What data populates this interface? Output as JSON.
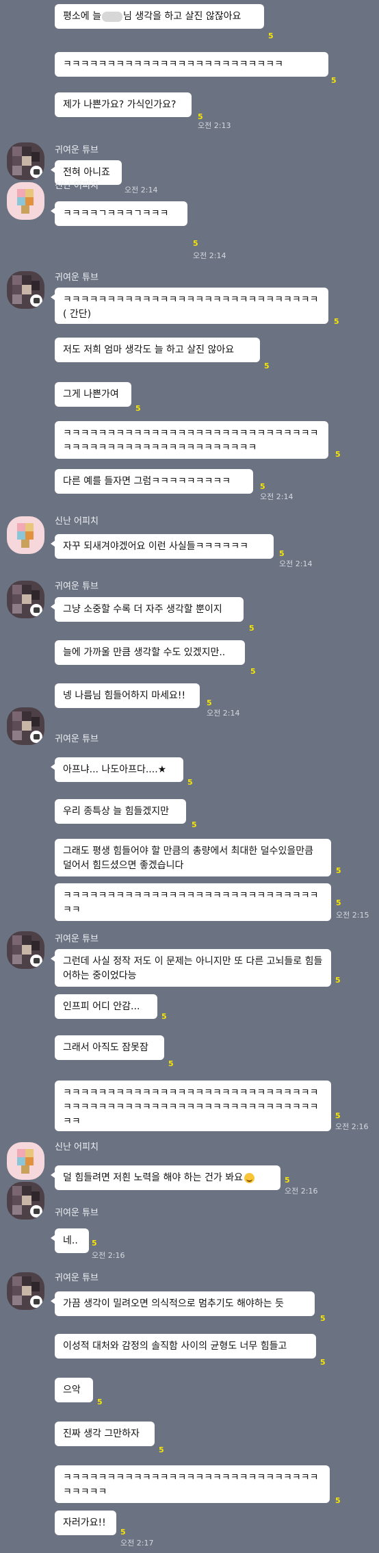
{
  "read_marker": "5",
  "senders": {
    "tube": "귀여운 튜브",
    "apeach": "신난 어피치"
  },
  "messages": {
    "m1a": "평소에 늘",
    "m1b": "님 생각을 하고 살진 않잖아요",
    "m2": "ㅋㅋㅋㅋㅋㅋㅋㅋㅋㅋㅋㅋㅋㅋㅋㅋㅋㅋㅋㅋㅋㅋㅋㅋㅋ",
    "m3": "제가 나쁜가요? 가식인가요?",
    "m4": "전혀 아니죠",
    "m5": "ㅋㅋㅋㅋㄱㅋㅋㅋㄱㅋㅋㅋ",
    "m6": "ㅋㅋㅋㅋㅋㅋㅋㅋㅋㅋㅋㅋㅋㅋㅋㅋㅋㅋㅋㅋㅋㅋㅋㅋㅋㅋㅋㅋㅋ( 간단)",
    "m7": "저도 저희 엄마 생각도 늘 하고 살진 않아요",
    "m8": "그게 나쁜가여",
    "m9": "ㅋㅋㅋㅋㅋㅋㅋㅋㅋㅋㅋㅋㅋㅋㅋㅋㅋㅋㅋㅋㅋㅋㅋㅋㅋㅋㅋㅋㅋㅋㅋㅋㅋㅋㅋㅋㅋㅋㅋㅋㅋㅋㅋㅋㅋㅋㅋㅋㅋㅋㅋ",
    "m10": "다른 예를 들자면 그럼ㅋㅋㅋㅋㅋㅋㅋㅋㅋ",
    "m11": "자꾸 되새겨야겠어요 이런 사실들ㅋㅋㅋㅋㅋㅋ",
    "m12": "그냥 소중할 수록 더 자주 생각할 뿐이지",
    "m13": "늘에 가까울 만큼 생각할 수도 있겠지만..",
    "m14": "넹 나름님 힘들어하지 마세요!!",
    "m15": "아프냐... 나도아프다....★",
    "m16": "우리 종특상 늘 힘들겠지만",
    "m17": "그래도 평생 힘들어야 할 만큼의 총량에서 최대한 덜수있을만큼 덜어서 힘드셨으면 좋겠습니다",
    "m18": "ㅋㅋㅋㅋㅋㅋㅋㅋㅋㅋㅋㅋㅋㅋㅋㅋㅋㅋㅋㅋㅋㅋㅋㅋㅋㅋㅋㅋㅋㅋㅋ",
    "m19": "그런데 사실 정작 저도 이 문제는 아니지만 또 다른 고뇌들로 힘들어하는 중이었다능",
    "m20": "인프피 어디 안감...",
    "m21": "그래서 아직도 잠못잠",
    "m22": "ㅋㅋㅋㅋㅋㅋㅋㅋㅋㅋㅋㅋㅋㅋㅋㅋㅋㅋㅋㅋㅋㅋㅋㅋㅋㅋㅋㅋㅋㅋㅋㅋㅋㅋㅋㅋㅋㅋㅋㅋㅋㅋㅋㅋㅋㅋㅋㅋㅋㅋㅋㅋㅋㅋㅋㅋㅋㅋㅋㅋ",
    "m23": "덜 힘들려면 저흰 노력을 해야 하는 건가 봐요",
    "m24": "네..",
    "m25": "가끔 생각이 밀려오면 의식적으로 멈추기도 해야하는 듯",
    "m26": "이성적 대처와 감정의 솔직함 사이의 균형도 너무 힘들고",
    "m27": "으악",
    "m28": "진짜 생각 그만하자",
    "m29": "ㅋㅋㅋㅋㅋㅋㅋㅋㅋㅋㅋㅋㅋㅋㅋㅋㅋㅋㅋㅋㅋㅋㅋㅋㅋㅋㅋㅋㅋㅋㅋㅋㅋㅋ",
    "m30": "자러가요!!"
  },
  "times": {
    "t3": "오전 2:13",
    "t4": "오전 2:14",
    "t5": "오전 2:14",
    "t10": "오전 2:14",
    "t11": "오전 2:14",
    "t14": "오전 2:14",
    "t18": "오전 2:15",
    "t22": "오전 2:16",
    "t23": "오전 2:16",
    "t24": "오전 2:16",
    "t30": "오전 2:17"
  },
  "colors": {
    "background": "#6b7282",
    "bubble": "#ffffff",
    "read_marker": "#f7e600"
  },
  "icons": {
    "profile_badge": "talk-bubble-icon",
    "emoji": "smiling-face-icon"
  }
}
